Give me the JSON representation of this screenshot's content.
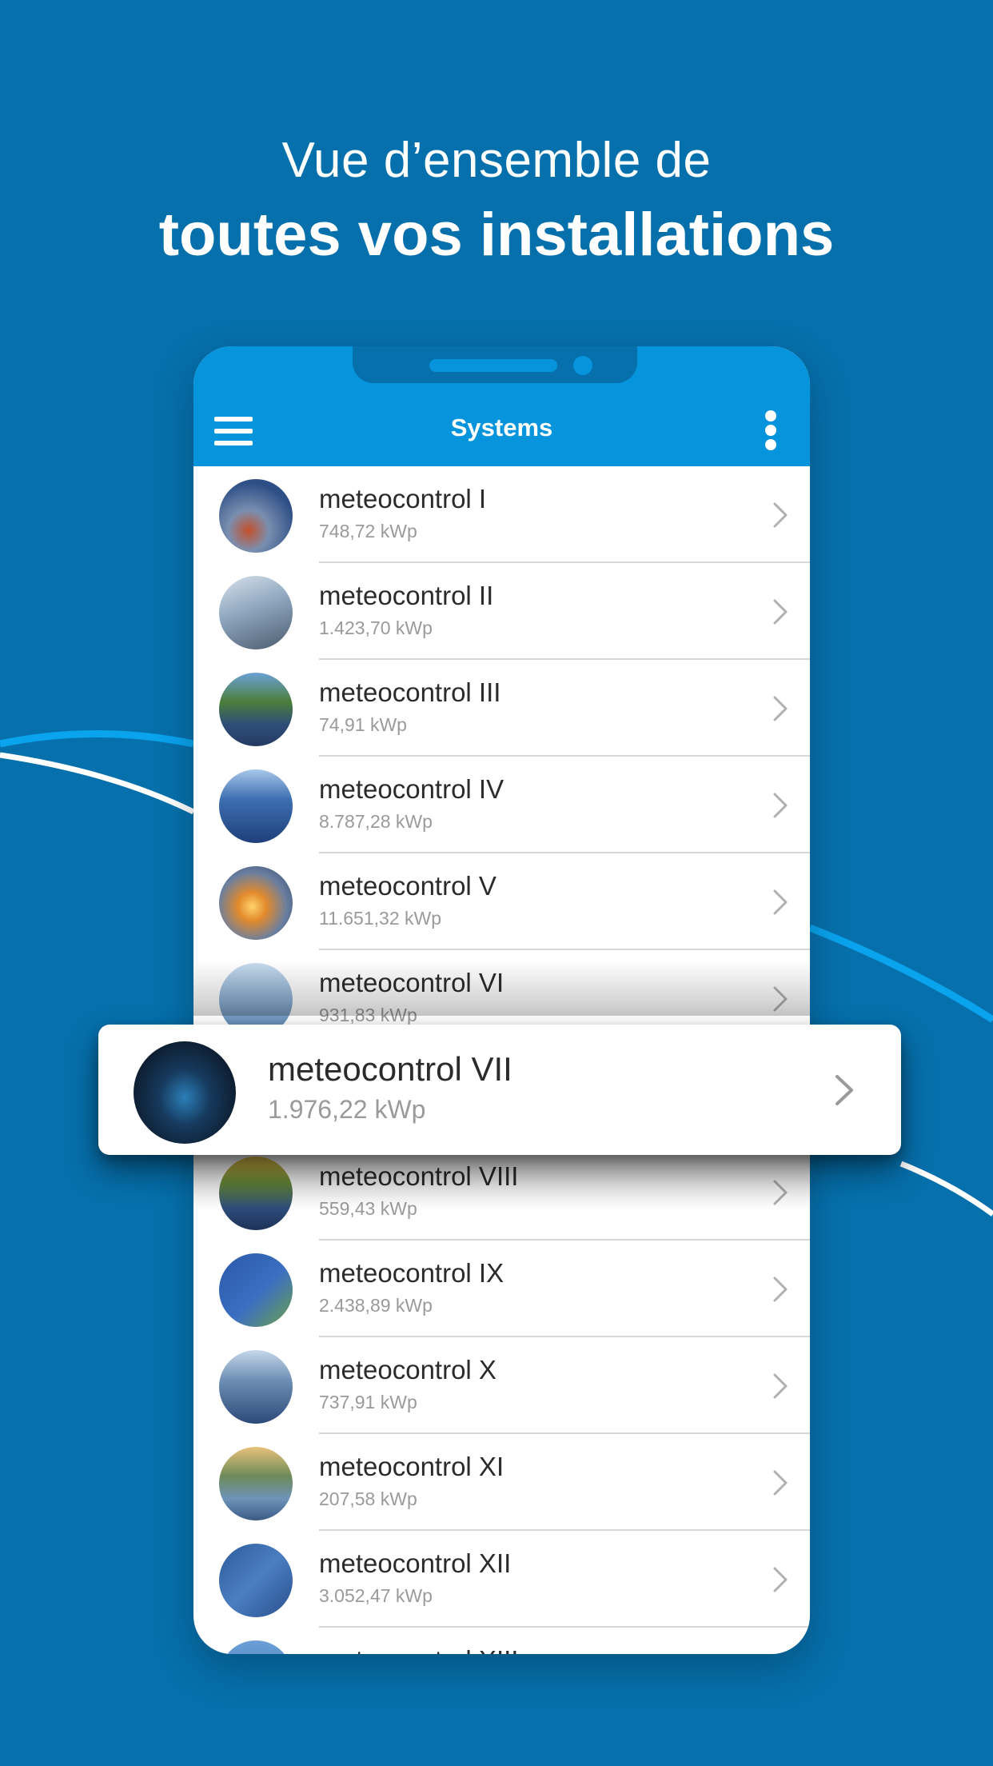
{
  "headline": {
    "line1": "Vue d’ensemble de",
    "line2": "toutes vos installations"
  },
  "colors": {
    "background": "#0670ac",
    "appbar": "#0694dd",
    "curve_light": "#0aa3ee",
    "curve_white": "#ffffff"
  },
  "appbar": {
    "menu_icon": "hamburger-icon",
    "title": "Systems",
    "more_icon": "more-vert-icon"
  },
  "systems": [
    {
      "name": "meteocontrol I",
      "capacity": "748,72 kWp"
    },
    {
      "name": "meteocontrol II",
      "capacity": "1.423,70 kWp"
    },
    {
      "name": "meteocontrol III",
      "capacity": "74,91 kWp"
    },
    {
      "name": "meteocontrol IV",
      "capacity": "8.787,28 kWp"
    },
    {
      "name": "meteocontrol V",
      "capacity": "11.651,32 kWp"
    },
    {
      "name": "meteocontrol VI",
      "capacity": "931,83 kWp"
    },
    {
      "name": "meteocontrol VII",
      "capacity": "1.976,22 kWp"
    },
    {
      "name": "meteocontrol VIII",
      "capacity": "559,43 kWp"
    },
    {
      "name": "meteocontrol IX",
      "capacity": "2.438,89 kWp"
    },
    {
      "name": "meteocontrol X",
      "capacity": "737,91 kWp"
    },
    {
      "name": "meteocontrol XI",
      "capacity": "207,58 kWp"
    },
    {
      "name": "meteocontrol XII",
      "capacity": "3.052,47 kWp"
    },
    {
      "name": "meteocontrol XIII",
      "capacity": ""
    }
  ],
  "highlighted": {
    "name": "meteocontrol VII",
    "capacity": "1.976,22 kWp"
  }
}
